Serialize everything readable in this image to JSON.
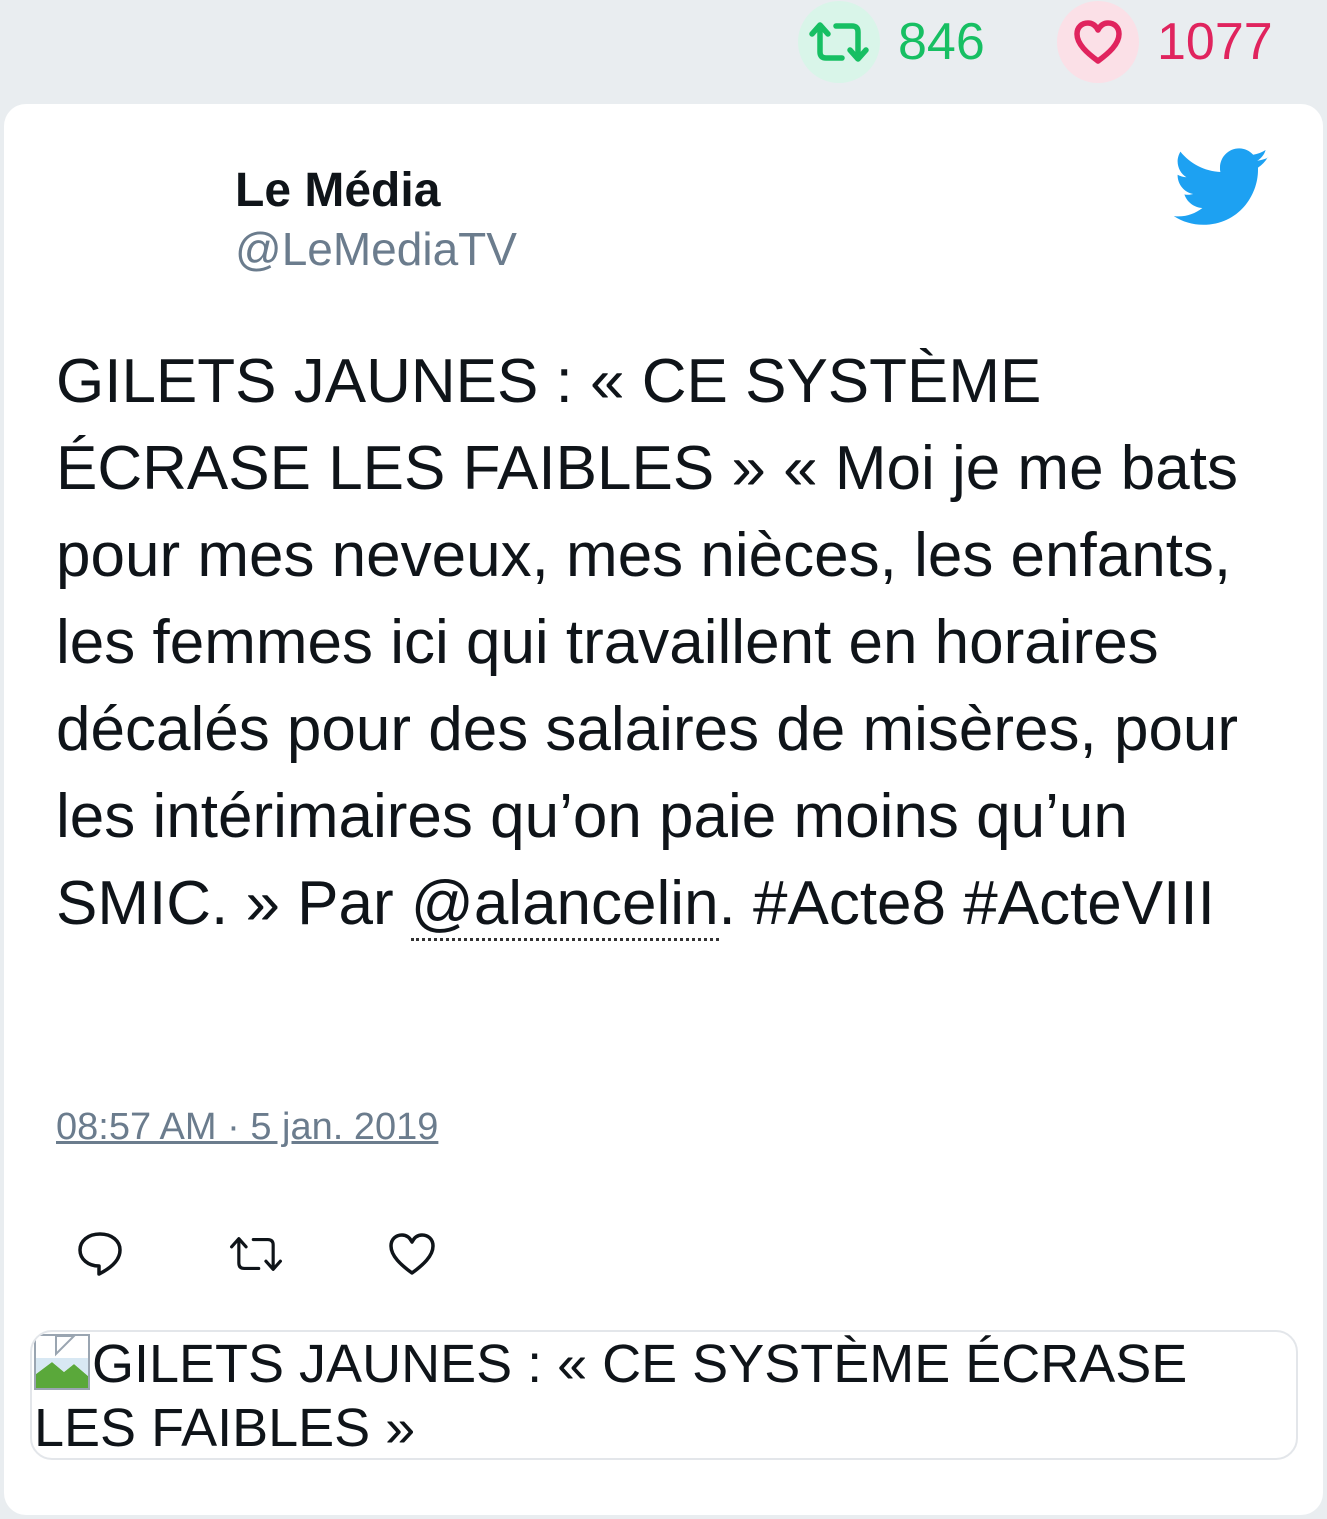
{
  "stats": {
    "retweet_count": "846",
    "like_count": "1077"
  },
  "author": {
    "name": "Le Média",
    "handle": "@LeMediaTV"
  },
  "tweet": {
    "text_before_mention": "GILETS JAUNES : « CE SYSTÈME ÉCRASE LES FAIBLES » « Moi je me bats pour mes neveux, mes nièces, les enfants, les femmes ici qui travaillent en horaires décalés pour des salaires de misères, pour les intérimaires qu’on paie moins qu’un SMIC. » Par ",
    "mention": "@alancelin",
    "text_after_mention": ". #Acte8 #ActeVIII",
    "timestamp": "08:57 AM · 5 jan. 2019"
  },
  "link_card": {
    "title": "GILETS JAUNES : « CE SYSTÈME ÉCRASE LES FAIBLES »"
  },
  "colors": {
    "retweet": "#17bf63",
    "like": "#e0245e",
    "twitter_blue": "#1da1f2",
    "secondary_text": "#6b7c8d"
  },
  "icons": {
    "retweet": "retweet-icon",
    "like": "heart-icon",
    "reply": "reply-icon",
    "brand": "twitter-bird-icon"
  }
}
